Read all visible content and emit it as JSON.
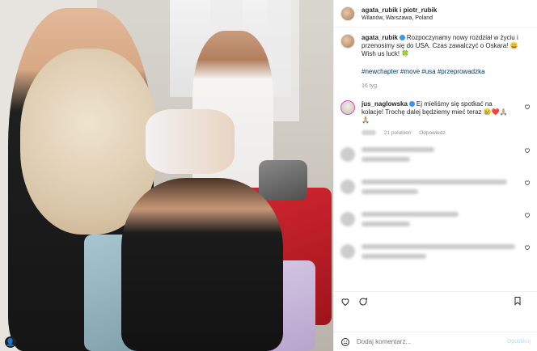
{
  "post": {
    "account": "agata_rubik i piotr_rubik",
    "location": "Wilanów, Warszawa, Poland"
  },
  "caption": {
    "username": "agata_rubik",
    "text": "Rozpoczynamy nowy rozdział w życiu i przenosimy się do USA. Czas zawalczyć o Oskara! 😀 Wish us luck! 🍀",
    "hashtags": "#newchapter #move #usa #przeprowadzka",
    "age": "16 tyg."
  },
  "comments": [
    {
      "username": "jus_naglowska",
      "text": "Ej mieliśmy się spotkać na kolacje! Trochę dalej będziemy mieć teraz 😢❤️🙏🏼🙏🏼",
      "likes": "21 polubień",
      "reply": "Odpowiedz"
    }
  ],
  "add_comment": {
    "placeholder": "Dodaj komentarz...",
    "post_label": "Opublikuj"
  },
  "colors": {
    "link": "#00376b",
    "verified": "#3897f0",
    "muted": "#8e8e8e"
  }
}
